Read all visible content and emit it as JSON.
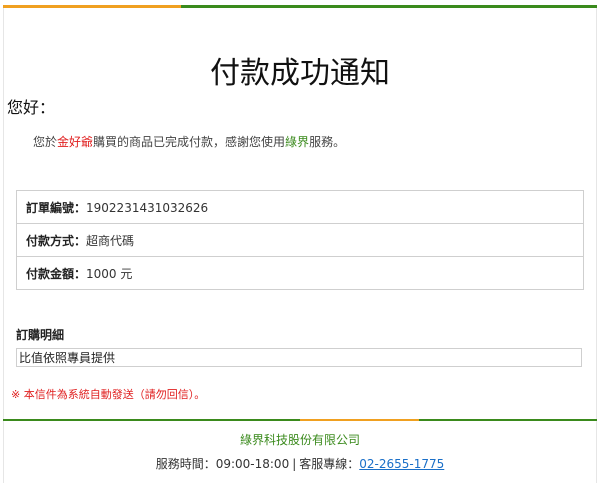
{
  "title": "付款成功通知",
  "greeting": "您好：",
  "message": {
    "prefix": "您於",
    "shop": "金好爺",
    "middle": "購買的商品已完成付款，感謝您使用",
    "brand": "綠界",
    "suffix": "服務。"
  },
  "order": {
    "number_label": "訂單編號：",
    "number_value": "1902231431032626",
    "method_label": "付款方式：",
    "method_value": "超商代碼",
    "amount_label": "付款金額：",
    "amount_value": "1000 元"
  },
  "details": {
    "title": "訂購明細",
    "content": "比值依照專員提供"
  },
  "notice": "※ 本信件為系統自動發送（請勿回信）。",
  "footer": {
    "company": "綠界科技股份有限公司",
    "hours_label": "服務時間：09:00-18:00",
    "separator": "|",
    "hotline_label": "客服專線：",
    "hotline_number": "02-2655-1775"
  },
  "colors": {
    "accent_green": "#3a8a1c",
    "accent_orange": "#f0a020",
    "highlight_red": "#e02020",
    "link_blue": "#1a6fc8"
  }
}
